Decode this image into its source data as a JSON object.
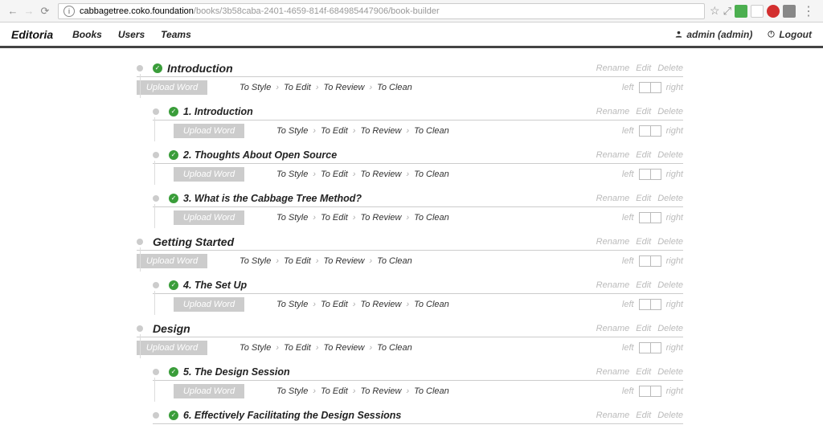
{
  "browser": {
    "url_host": "cabbagetree.coko.foundation",
    "url_path": "/books/3b58caba-2401-4659-814f-684985447906/book-builder"
  },
  "header": {
    "brand": "Editoria",
    "nav": [
      "Books",
      "Users",
      "Teams"
    ],
    "user": "admin (admin)",
    "logout": "Logout"
  },
  "actions": {
    "rename": "Rename",
    "edit": "Edit",
    "delete": "Delete",
    "upload": "Upload Word",
    "left": "left",
    "right": "right"
  },
  "workflow": [
    "To Style",
    "To Edit",
    "To Review",
    "To Clean"
  ],
  "items": [
    {
      "level": "part",
      "checked": true,
      "title": "Introduction"
    },
    {
      "level": "chapter",
      "checked": true,
      "title": "1. Introduction"
    },
    {
      "level": "chapter",
      "checked": true,
      "title": "2. Thoughts About Open Source"
    },
    {
      "level": "chapter",
      "checked": true,
      "title": "3. What is the Cabbage Tree Method?"
    },
    {
      "level": "part",
      "checked": false,
      "title": "Getting Started"
    },
    {
      "level": "chapter",
      "checked": true,
      "title": "4. The Set Up"
    },
    {
      "level": "part",
      "checked": false,
      "title": "Design"
    },
    {
      "level": "chapter",
      "checked": true,
      "title": "5. The Design Session"
    },
    {
      "level": "chapter",
      "checked": true,
      "title": "6. Effectively Facilitating the Design Sessions"
    }
  ]
}
